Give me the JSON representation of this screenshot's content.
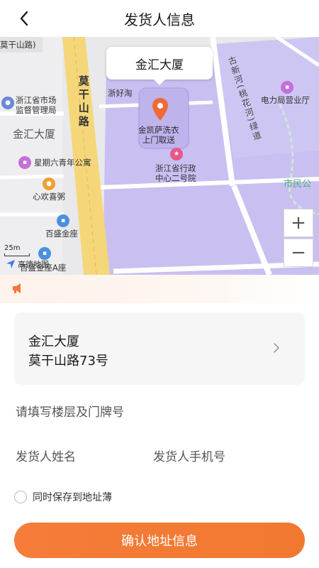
{
  "header": {
    "title": "发货人信息"
  },
  "map": {
    "callout": "金汇大厦",
    "labels": {
      "road_moganshan_top": "莫干山路)",
      "road_moganshan": "莫干山路",
      "zhejiang_market": "浙江省市场\n监督管理局",
      "jinhui_building": "金汇大厦",
      "zhehaotao": "浙好淘",
      "jinkaisa": "金凯萨洗衣\n上门取送",
      "xingqiliu": "星期六青年公寓",
      "xinhuan": "心欢喜粥",
      "baisheng": "百盛金座",
      "baisheng_a": "百盛金座A座",
      "zhejiang_admin": "浙江省行政\n中心二号院",
      "guxinhe": "古新河(桃花河)绿道",
      "power_bureau": "电力局营业厅",
      "shiminggong": "市民公",
      "gaode": "高德地图"
    },
    "scale": "25m",
    "zoom_in": "+",
    "zoom_out": "−"
  },
  "address": {
    "name": "金汇大厦",
    "street": "莫干山路73号"
  },
  "form": {
    "floor_placeholder": "请填写楼层及门牌号",
    "sender_name": "发货人姓名",
    "sender_phone": "发货人手机号",
    "save_label": "同时保存到地址薄"
  },
  "confirm_label": "确认地址信息",
  "colors": {
    "accent": "#f57c3a",
    "map_purple": "#c9bff0",
    "road_yellow": "#f5d77a"
  }
}
